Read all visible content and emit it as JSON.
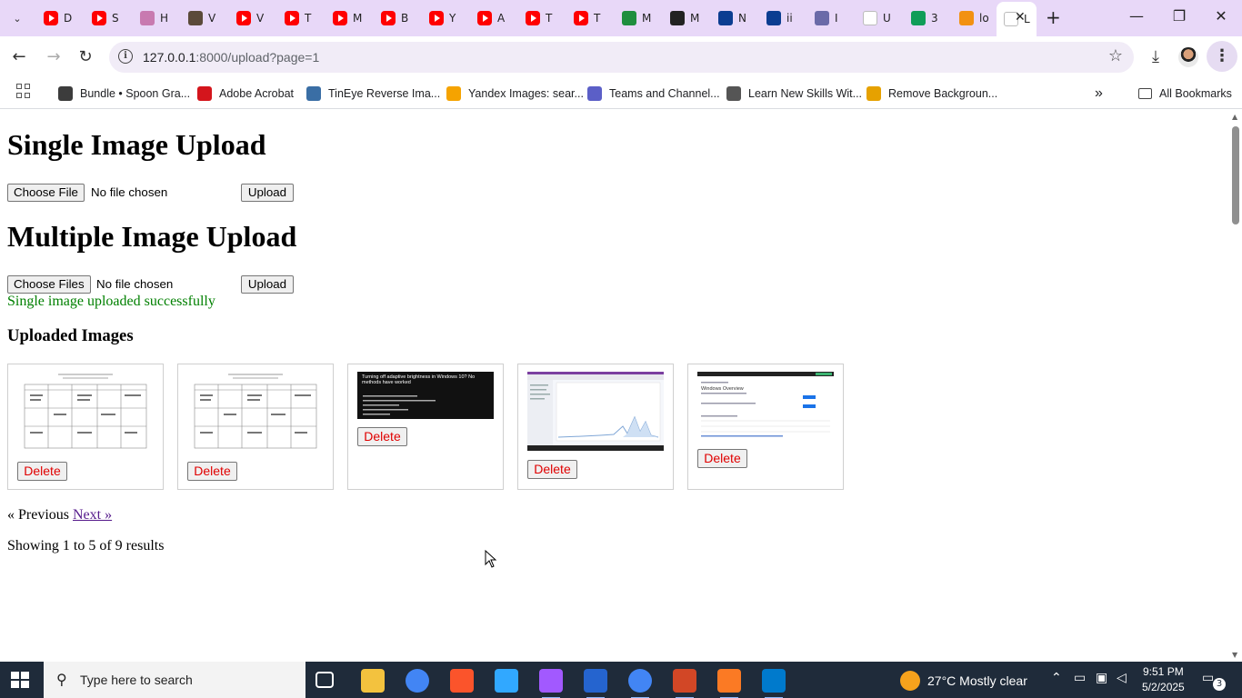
{
  "browser": {
    "tabs": [
      {
        "label": "D",
        "icon": "youtube-icon"
      },
      {
        "label": "S",
        "icon": "youtube-icon"
      },
      {
        "label": "H",
        "icon": "puzzle-icon"
      },
      {
        "label": "V",
        "icon": "photo-icon"
      },
      {
        "label": "V",
        "icon": "youtube-icon"
      },
      {
        "label": "T",
        "icon": "youtube-icon"
      },
      {
        "label": "M",
        "icon": "youtube-icon"
      },
      {
        "label": "B",
        "icon": "youtube-icon"
      },
      {
        "label": "Y",
        "icon": "youtube-icon"
      },
      {
        "label": "A",
        "icon": "youtube-icon"
      },
      {
        "label": "T",
        "icon": "youtube-icon"
      },
      {
        "label": "T",
        "icon": "youtube-icon"
      },
      {
        "label": "M",
        "icon": "classroom-icon"
      },
      {
        "label": "M",
        "icon": "openai-icon"
      },
      {
        "label": "N",
        "icon": "nasa-icon"
      },
      {
        "label": "ii",
        "icon": "nasa-icon"
      },
      {
        "label": "I",
        "icon": "globe-icon"
      },
      {
        "label": "U",
        "icon": "google-icon"
      },
      {
        "label": "3",
        "icon": "sheets-icon"
      },
      {
        "label": "lo",
        "icon": "pma-icon"
      },
      {
        "label": "L",
        "icon": "page-icon",
        "active": true
      }
    ],
    "url_host": "127.0.0.1",
    "url_rest": ":8000/upload?page=1",
    "bookmarks": [
      {
        "label": "Bundle • Spoon Gra...",
        "color": "#3c3c3c"
      },
      {
        "label": "Adobe Acrobat",
        "color": "#d4151c"
      },
      {
        "label": "TinEye Reverse Ima...",
        "color": "#3a6ea5"
      },
      {
        "label": "Yandex Images: sear...",
        "color": "#f5a300"
      },
      {
        "label": "Teams and Channel...",
        "color": "#5b5fc7"
      },
      {
        "label": "Learn New Skills Wit...",
        "color": "#555555"
      },
      {
        "label": "Remove Backgroun...",
        "color": "#e6a100"
      }
    ],
    "all_bookmarks": "All Bookmarks"
  },
  "page": {
    "single_title": "Single Image Upload",
    "single_choose": "Choose File",
    "single_no_file": "No file chosen",
    "single_upload": "Upload",
    "multi_title": "Multiple Image Upload",
    "multi_choose": "Choose Files",
    "multi_no_file": "No file chosen",
    "multi_upload": "Upload",
    "success_message": "Single image uploaded successfully",
    "uploaded_title": "Uploaded Images",
    "images": [
      {
        "kind": "timetable",
        "delete_label": "Delete"
      },
      {
        "kind": "timetable",
        "delete_label": "Delete"
      },
      {
        "kind": "dark-article",
        "delete_label": "Delete",
        "caption": "Turning off adaptive brightness in Windows 10? No methods have worked"
      },
      {
        "kind": "chart-screenshot",
        "delete_label": "Delete"
      },
      {
        "kind": "dashboard",
        "delete_label": "Delete",
        "caption": "Windows Overview"
      }
    ],
    "pager_prev": "« Previous",
    "pager_next": "Next »",
    "results_text": "Showing 1 to 5 of 9 results"
  },
  "taskbar": {
    "search_placeholder": "Type here to search",
    "weather": "27°C  Mostly clear",
    "time": "9:51 PM",
    "date": "5/2/2025",
    "notification_count": "3",
    "apps": [
      {
        "name": "task-view",
        "color": "#ffffff"
      },
      {
        "name": "file-explorer",
        "color": "#f3c23e"
      },
      {
        "name": "chrome",
        "color": "#4285f4"
      },
      {
        "name": "brave",
        "color": "#fb542b"
      },
      {
        "name": "photoshop",
        "color": "#31a8ff"
      },
      {
        "name": "figma",
        "color": "#a259ff"
      },
      {
        "name": "todo",
        "color": "#2564cf"
      },
      {
        "name": "chrome-profile",
        "color": "#4285f4"
      },
      {
        "name": "powerpoint",
        "color": "#d24726"
      },
      {
        "name": "xampp",
        "color": "#fb7a24"
      },
      {
        "name": "vscode",
        "color": "#007acc"
      }
    ]
  }
}
